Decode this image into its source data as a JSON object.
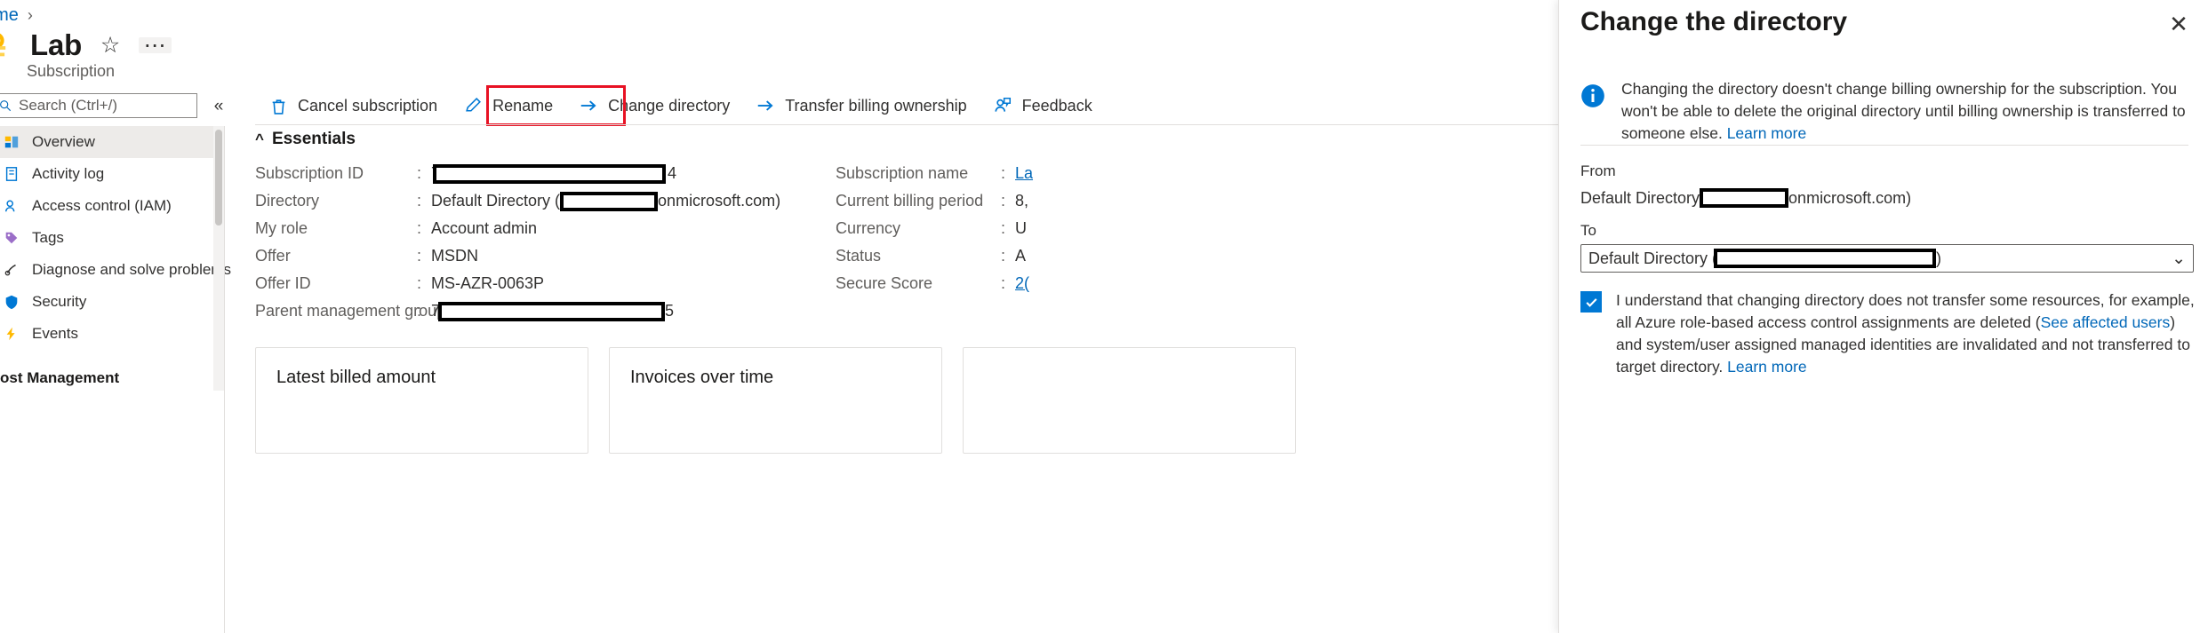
{
  "breadcrumb": {
    "home": "ome",
    "separator": "›"
  },
  "header": {
    "title": "Lab",
    "subtitle": "Subscription",
    "favorite_icon": "star-icon",
    "more_icon": "ellipsis-icon",
    "resource_icon": "key-icon"
  },
  "search": {
    "placeholder": "Search (Ctrl+/)",
    "icon": "search-icon",
    "collapse_icon": "double-chevron-left-icon"
  },
  "sidebar": {
    "items": [
      {
        "label": "Overview",
        "icon": "overview-icon",
        "selected": true
      },
      {
        "label": "Activity log",
        "icon": "activity-log-icon",
        "selected": false
      },
      {
        "label": "Access control (IAM)",
        "icon": "access-control-icon",
        "selected": false
      },
      {
        "label": "Tags",
        "icon": "tags-icon",
        "selected": false
      },
      {
        "label": "Diagnose and solve problems",
        "icon": "diagnose-icon",
        "selected": false
      },
      {
        "label": "Security",
        "icon": "shield-icon",
        "selected": false
      },
      {
        "label": "Events",
        "icon": "events-icon",
        "selected": false
      }
    ],
    "group_label": "ost Management"
  },
  "toolbar": {
    "buttons": [
      {
        "label": "Cancel subscription",
        "icon": "trash-icon"
      },
      {
        "label": "Rename",
        "icon": "pencil-icon"
      },
      {
        "label": "Change directory",
        "icon": "arrow-right-icon",
        "highlighted": true
      },
      {
        "label": "Transfer billing ownership",
        "icon": "arrow-right-icon"
      },
      {
        "label": "Feedback",
        "icon": "feedback-person-icon"
      }
    ],
    "highlight_color": "#e81123"
  },
  "essentials": {
    "heading": "Essentials",
    "collapse_icon": "chevron-up-icon",
    "left": [
      {
        "key": "Subscription ID",
        "prefix": "7",
        "redacted": true,
        "redact_width": 262,
        "suffix": "4"
      },
      {
        "key": "Directory",
        "prefix": "Default Directory (",
        "redacted": true,
        "redact_width": 110,
        "suffix": "onmicrosoft.com)"
      },
      {
        "key": "My role",
        "prefix": "Account admin",
        "redacted": false,
        "suffix": ""
      },
      {
        "key": "Offer",
        "prefix": "MSDN",
        "redacted": false,
        "suffix": ""
      },
      {
        "key": "Offer ID",
        "prefix": "MS-AZR-0063P",
        "redacted": false,
        "suffix": ""
      },
      {
        "key": "Parent management group",
        "prefix": "7",
        "redacted": true,
        "redact_width": 255,
        "suffix": "5"
      }
    ],
    "right": [
      {
        "key": "Subscription name",
        "value": "La",
        "link": true
      },
      {
        "key": "Current billing period",
        "value": "8,",
        "link": false
      },
      {
        "key": "Currency",
        "value": "U",
        "link": false
      },
      {
        "key": "Status",
        "value": "A",
        "link": false
      },
      {
        "key": "Secure Score",
        "value": "2(",
        "link": true
      }
    ]
  },
  "cards": [
    {
      "title": "Latest billed amount"
    },
    {
      "title": "Invoices over time"
    }
  ],
  "panel": {
    "title": "Change the directory",
    "close_icon": "close-icon",
    "info": {
      "icon": "info-icon",
      "text": "Changing the directory doesn't change billing ownership for the subscription. You won't be able to delete the original directory until billing ownership is transferred to someone else. ",
      "link": "Learn more"
    },
    "from": {
      "label": "From",
      "prefix": "Default Directory ",
      "redact_width": 100,
      "suffix": "onmicrosoft.com)"
    },
    "to": {
      "label": "To",
      "prefix": "Default Directory (",
      "redact_width": 250,
      "suffix": ")",
      "chevron_icon": "chevron-down-icon"
    },
    "consent": {
      "checked": true,
      "text_part1": "I understand that changing directory does not transfer some resources, for example, all Azure role-based access control assignments are deleted (",
      "link1": "See affected users",
      "text_part2": ") and system/user assigned managed identities are invalidated and not transferred to target directory. ",
      "link2": "Learn more"
    }
  },
  "colors": {
    "accent": "#0078d4",
    "link": "#0067b8",
    "highlight": "#e81123",
    "selected_bg": "#edebe9"
  }
}
